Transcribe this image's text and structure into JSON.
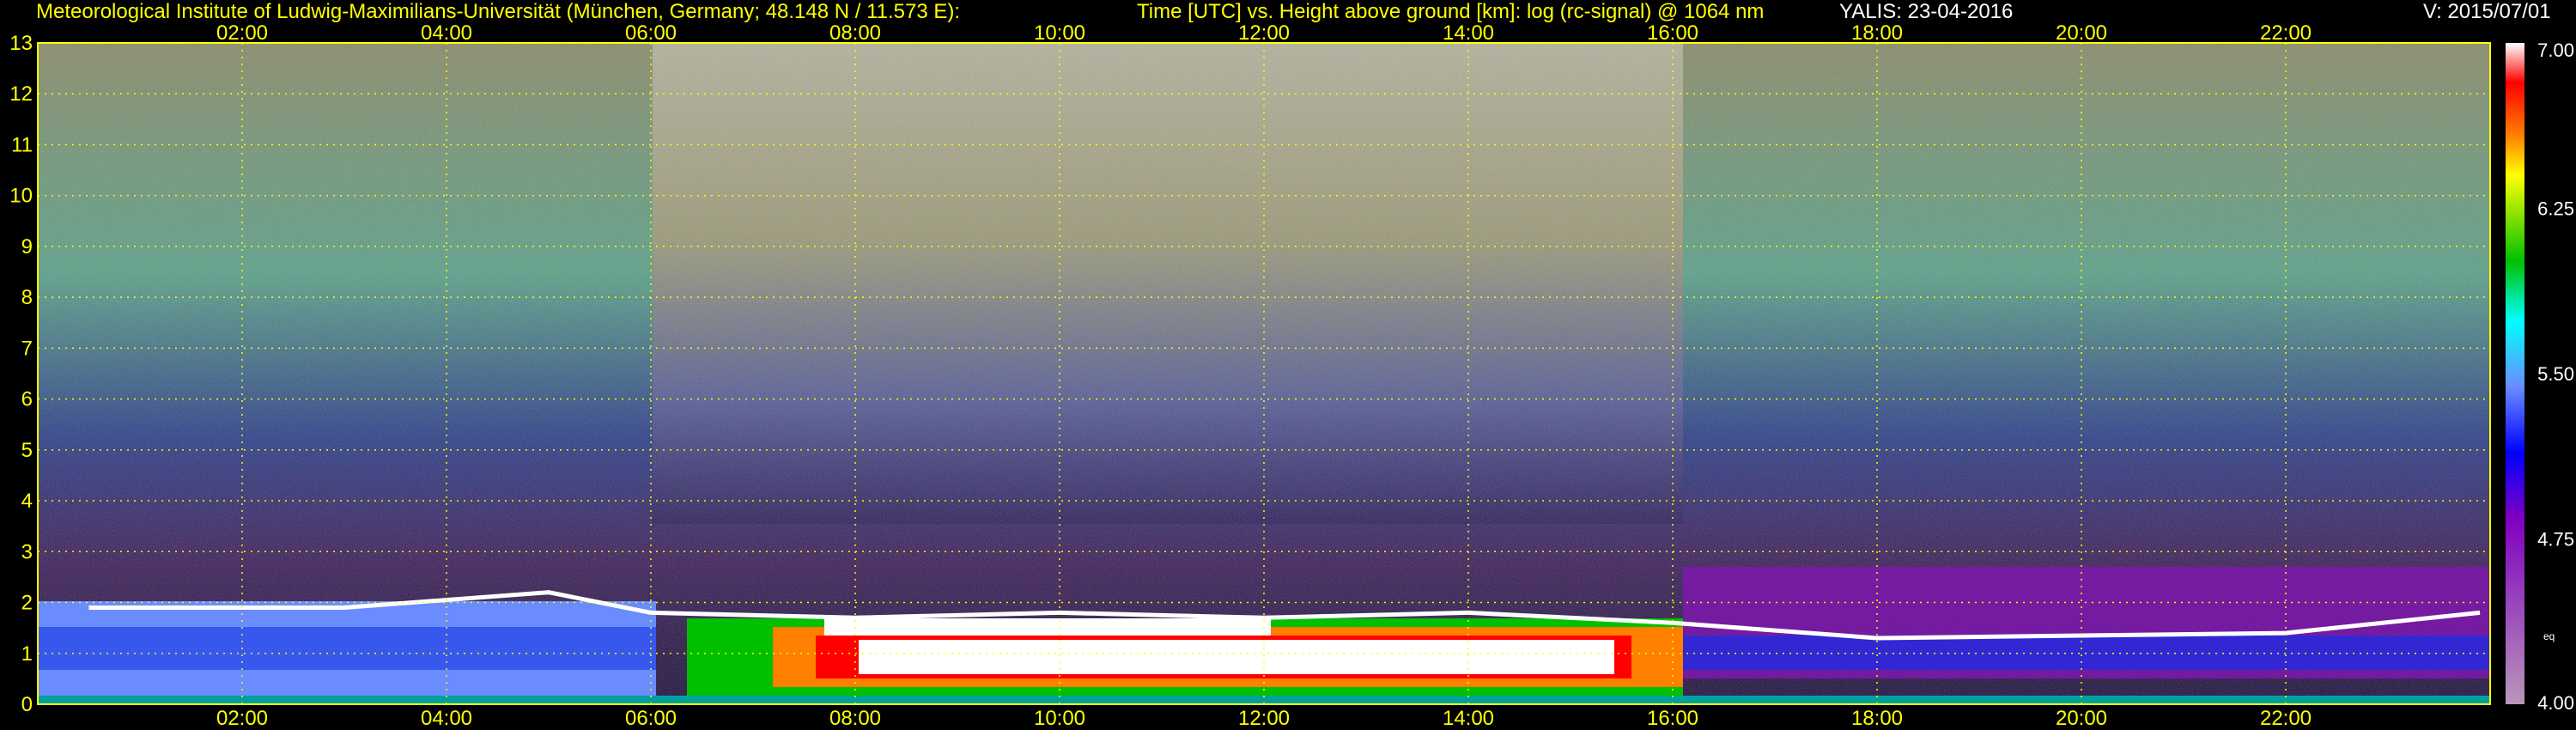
{
  "header": {
    "institute": "Meteorological Institute of Ludwig-Maximilians-Universität (München, Germany; 48.148 N / 11.573 E):",
    "title": "Time [UTC] vs. Height above ground [km]: log (rc-signal) @ 1064 nm",
    "instrument_date": "YALIS: 23-04-2016",
    "version": "V: 2015/07/01"
  },
  "chart_data": {
    "type": "heatmap",
    "title": "Time [UTC] vs. Height above ground [km]: log (rc-signal) @ 1064 nm",
    "xlabel": "Time [UTC]",
    "ylabel": "Height above ground [km]",
    "x_ticks": [
      "02:00",
      "04:00",
      "06:00",
      "08:00",
      "10:00",
      "12:00",
      "14:00",
      "16:00",
      "18:00",
      "20:00",
      "22:00"
    ],
    "x_tick_values": [
      2,
      4,
      6,
      8,
      10,
      12,
      14,
      16,
      18,
      20,
      22
    ],
    "xlim": [
      0,
      24
    ],
    "y_ticks": [
      "0",
      "1",
      "2",
      "3",
      "4",
      "5",
      "6",
      "7",
      "8",
      "9",
      "10",
      "11",
      "12",
      "13"
    ],
    "y_tick_values": [
      0,
      1,
      2,
      3,
      4,
      5,
      6,
      7,
      8,
      9,
      10,
      11,
      12,
      13
    ],
    "ylim": [
      0,
      13
    ],
    "grid": true,
    "colorbar": {
      "ticks": [
        "7.00",
        "6.25",
        "5.50",
        "4.75",
        "4.00"
      ],
      "tick_values": [
        7.0,
        6.25,
        5.5,
        4.75,
        4.0
      ],
      "range": [
        4.0,
        7.0
      ],
      "flag_label": "eq",
      "colors": [
        "#ffffff",
        "#ff0000",
        "#ff8000",
        "#ffff00",
        "#00c000",
        "#00ffff",
        "#6b8cff",
        "#0000ff",
        "#8000c0",
        "#b898b8"
      ]
    },
    "boundary_layer_top_km": [
      {
        "time": 0.5,
        "height": 1.9
      },
      {
        "time": 3.0,
        "height": 1.9
      },
      {
        "time": 5.0,
        "height": 2.2
      },
      {
        "time": 6.0,
        "height": 1.8
      },
      {
        "time": 8.0,
        "height": 1.7
      },
      {
        "time": 10.0,
        "height": 1.8
      },
      {
        "time": 12.0,
        "height": 1.7
      },
      {
        "time": 14.0,
        "height": 1.8
      },
      {
        "time": 16.0,
        "height": 1.6
      },
      {
        "time": 18.0,
        "height": 1.3
      },
      {
        "time": 22.0,
        "height": 1.4
      },
      {
        "time": 23.9,
        "height": 1.8
      }
    ]
  }
}
